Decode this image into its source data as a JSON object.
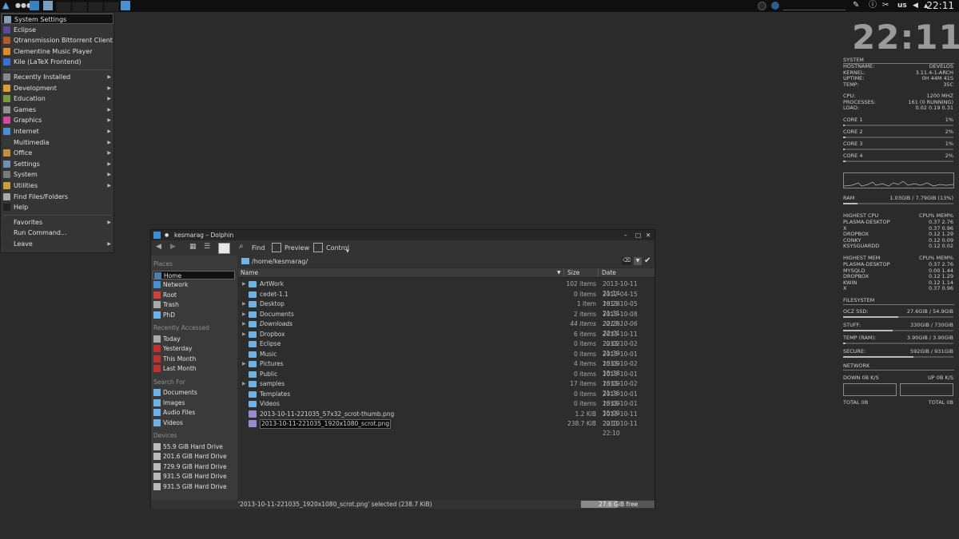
{
  "panel": {
    "kbd": "us",
    "time": "22:11"
  },
  "menu": {
    "pinned": [
      {
        "label": "System Settings",
        "icon": "settings-icon",
        "color": "#8a9bb5"
      },
      {
        "label": "Eclipse",
        "icon": "eclipse-icon",
        "color": "#5b4a9c"
      },
      {
        "label": "Qtransmission Bittorrent Client",
        "icon": "transmission-icon",
        "color": "#b35a2a"
      },
      {
        "label": "Clementine Music Player",
        "icon": "clementine-icon",
        "color": "#e08a2a"
      },
      {
        "label": "Kile (LaTeX Frontend)",
        "icon": "kile-icon",
        "color": "#3a6fd8"
      }
    ],
    "categories": [
      {
        "label": "Recently Installed",
        "icon": "clock-icon",
        "color": "#888"
      },
      {
        "label": "Development",
        "icon": "development-icon",
        "color": "#d8a030"
      },
      {
        "label": "Education",
        "icon": "education-icon",
        "color": "#7a9a40"
      },
      {
        "label": "Games",
        "icon": "games-icon",
        "color": "#909090"
      },
      {
        "label": "Graphics",
        "icon": "graphics-icon",
        "color": "#d04aa0"
      },
      {
        "label": "Internet",
        "icon": "internet-icon",
        "color": "#4a90d0"
      },
      {
        "label": "Multimedia",
        "icon": "multimedia-icon",
        "color": "#3a3a3a"
      },
      {
        "label": "Office",
        "icon": "office-icon",
        "color": "#c09040"
      },
      {
        "label": "Settings",
        "icon": "settings-icon",
        "color": "#7090b0"
      },
      {
        "label": "System",
        "icon": "system-icon",
        "color": "#7a7a7a"
      },
      {
        "label": "Utilities",
        "icon": "utilities-icon",
        "color": "#c8a040"
      },
      {
        "label": "Find Files/Folders",
        "icon": "find-files-icon",
        "color": "#aaa"
      },
      {
        "label": "Help",
        "icon": "help-icon",
        "color": "#222"
      }
    ],
    "bottom": [
      {
        "label": "Favorites",
        "icon": "favorites-icon",
        "color": "#333"
      },
      {
        "label": "Run Command...",
        "icon": "run-icon",
        "color": "#333"
      },
      {
        "label": "Leave",
        "icon": "leave-icon",
        "color": "#333"
      }
    ]
  },
  "conky": {
    "clock": "22:11",
    "system": {
      "title": "SYSTEM",
      "rows": [
        {
          "k": "HOSTNAME:",
          "v": "DEVELOS"
        },
        {
          "k": "KERNEL:",
          "v": "3.11.4-1-ARCH"
        },
        {
          "k": "UPTIME:",
          "v": "0H 44M 41S"
        },
        {
          "k": "TEMP:",
          "v": "35C"
        }
      ],
      "rows2": [
        {
          "k": "CPU:",
          "v": "1200 MHZ"
        },
        {
          "k": "PROCESSES:",
          "v": "161 (0 RUNNING)"
        },
        {
          "k": "LOAD:",
          "v": "0.02 0.19 0.31"
        }
      ]
    },
    "cores": [
      {
        "k": "CORE 1",
        "v": "1%",
        "fill": 0.01
      },
      {
        "k": "CORE 2",
        "v": "2%",
        "fill": 0.02
      },
      {
        "k": "CORE 3",
        "v": "1%",
        "fill": 0.01
      },
      {
        "k": "CORE 4",
        "v": "2%",
        "fill": 0.02
      }
    ],
    "ram": {
      "k": "RAM",
      "v": "1.03GIB / 7.79GIB (13%)",
      "fill": 0.13
    },
    "topcpu": {
      "title": "HIGHEST CPU",
      "cols": "CPU% MEM%",
      "rows": [
        {
          "k": "PLASMA-DESKTOP",
          "v": "0.37  2.76"
        },
        {
          "k": "X",
          "v": "0.37  0.96"
        },
        {
          "k": "DROPBOX",
          "v": "0.12  1.29"
        },
        {
          "k": "CONKY",
          "v": "0.12  0.09"
        },
        {
          "k": "KSYSGUARDD",
          "v": "0.12  0.02"
        }
      ]
    },
    "topmem": {
      "title": "HIGHEST MEM",
      "cols": "CPU% MEM%",
      "rows": [
        {
          "k": "PLASMA-DESKTOP",
          "v": "0.37  2.76"
        },
        {
          "k": "MYSQLD",
          "v": "0.00  1.44"
        },
        {
          "k": "DROPBOX",
          "v": "0.12  1.29"
        },
        {
          "k": "KWIN",
          "v": "0.12  1.14"
        },
        {
          "k": "X",
          "v": "0.37  0.96"
        }
      ]
    },
    "fs": {
      "title": "FILESYSTEM",
      "rows": [
        {
          "k": "OCZ SSD:",
          "v": "27.6GIB / 54.9GIB",
          "fill": 0.5
        },
        {
          "k": "STUFF:",
          "v": "330GIB / 730GIB",
          "fill": 0.45
        },
        {
          "k": "TEMP (RAM):",
          "v": "3.90GIB / 3.90GIB",
          "fill": 0.02
        },
        {
          "k": "SECURE:",
          "v": "592GIB / 931GIB",
          "fill": 0.64
        }
      ]
    },
    "net": {
      "title": "NETWORK",
      "down": "DOWN 0B   K/S",
      "up": "UP 0B   K/S",
      "total_down": "TOTAL 0B",
      "total_up": "TOTAL 0B"
    }
  },
  "dolphin": {
    "title": "kesmarag – Dolphin",
    "toolbar": {
      "find": "Find",
      "preview": "Preview",
      "control": "Control"
    },
    "path": "/home/kesmarag/",
    "places_header": "Places",
    "places": [
      {
        "label": "Home",
        "icon": "home-icon",
        "color": "#4a7fb0"
      },
      {
        "label": "Network",
        "icon": "network-icon",
        "color": "#4a90d0"
      },
      {
        "label": "Root",
        "icon": "root-icon",
        "color": "#d04040"
      },
      {
        "label": "Trash",
        "icon": "trash-icon",
        "color": "#aaa"
      },
      {
        "label": "PhD",
        "icon": "folder-icon",
        "color": "#6fb3e6"
      }
    ],
    "recent_header": "Recently Accessed",
    "recent": [
      {
        "label": "Today",
        "icon": "clock-icon",
        "color": "#aaa"
      },
      {
        "label": "Yesterday",
        "icon": "calendar-icon",
        "color": "#c03030"
      },
      {
        "label": "This Month",
        "icon": "calendar-icon",
        "color": "#c03030"
      },
      {
        "label": "Last Month",
        "icon": "calendar-icon",
        "color": "#c03030"
      }
    ],
    "search_header": "Search For",
    "search": [
      {
        "label": "Documents",
        "icon": "documents-icon",
        "color": "#6fb3e6"
      },
      {
        "label": "Images",
        "icon": "images-icon",
        "color": "#6fb3e6"
      },
      {
        "label": "Audio Files",
        "icon": "audio-icon",
        "color": "#6fb3e6"
      },
      {
        "label": "Videos",
        "icon": "videos-icon",
        "color": "#6fb3e6"
      }
    ],
    "devices_header": "Devices",
    "devices": [
      {
        "label": "55.9 GiB Hard Drive",
        "icon": "drive-icon",
        "color": "#bbb"
      },
      {
        "label": "201.6 GiB Hard Drive",
        "icon": "drive-icon",
        "color": "#bbb"
      },
      {
        "label": "729.9 GiB Hard Drive",
        "icon": "drive-icon",
        "color": "#bbb"
      },
      {
        "label": "931.5 GiB Hard Drive",
        "icon": "drive-icon",
        "color": "#bbb"
      },
      {
        "label": "931.5 GiB Hard Drive",
        "icon": "drive-icon",
        "color": "#bbb"
      }
    ],
    "columns": {
      "name": "Name",
      "size": "Size",
      "date": "Date"
    },
    "files": [
      {
        "name": "ArtWork",
        "size": "102 items",
        "date": "2013-10-11 21:14",
        "expand": true
      },
      {
        "name": "cedet-1.1",
        "size": "0 items",
        "date": "2012-04-15 18:28",
        "expand": false
      },
      {
        "name": "Desktop",
        "size": "1 item",
        "date": "2013-10-05 21:31",
        "expand": true
      },
      {
        "name": "Documents",
        "size": "2 items",
        "date": "2013-10-08 22:28",
        "expand": true
      },
      {
        "name": "Downloads",
        "size": "44 items",
        "date": "2013-10-06 22:01",
        "expand": true
      },
      {
        "name": "Dropbox",
        "size": "6 items",
        "date": "2013-10-11 22:02",
        "expand": true
      },
      {
        "name": "Eclipse",
        "size": "0 items",
        "date": "2013-10-02 21:39",
        "expand": false
      },
      {
        "name": "Music",
        "size": "0 items",
        "date": "2013-10-01 15:09",
        "expand": false
      },
      {
        "name": "Pictures",
        "size": "4 items",
        "date": "2013-10-02 18:38",
        "expand": true
      },
      {
        "name": "Public",
        "size": "0 items",
        "date": "2013-10-01 15:09",
        "expand": false
      },
      {
        "name": "samples",
        "size": "17 items",
        "date": "2013-10-02 21:36",
        "expand": true
      },
      {
        "name": "Templates",
        "size": "0 items",
        "date": "2013-10-01 15:09",
        "expand": false
      },
      {
        "name": "Videos",
        "size": "0 items",
        "date": "2013-10-01 15:09",
        "expand": false
      },
      {
        "name": "2013-10-11-221035_57x32_scrot-thumb.png",
        "size": "1.2 KiB",
        "date": "2013-10-11 22:10",
        "expand": false
      },
      {
        "name": "2013-10-11-221035_1920x1080_scrot.png",
        "size": "238.7 KiB",
        "date": "2013-10-11 22:10",
        "expand": false
      }
    ],
    "status": "'2013-10-11-221035_1920x1080_scrot.png' selected (238.7 KiB)",
    "free": "27.6 GiB free",
    "free_fraction": 0.5
  }
}
